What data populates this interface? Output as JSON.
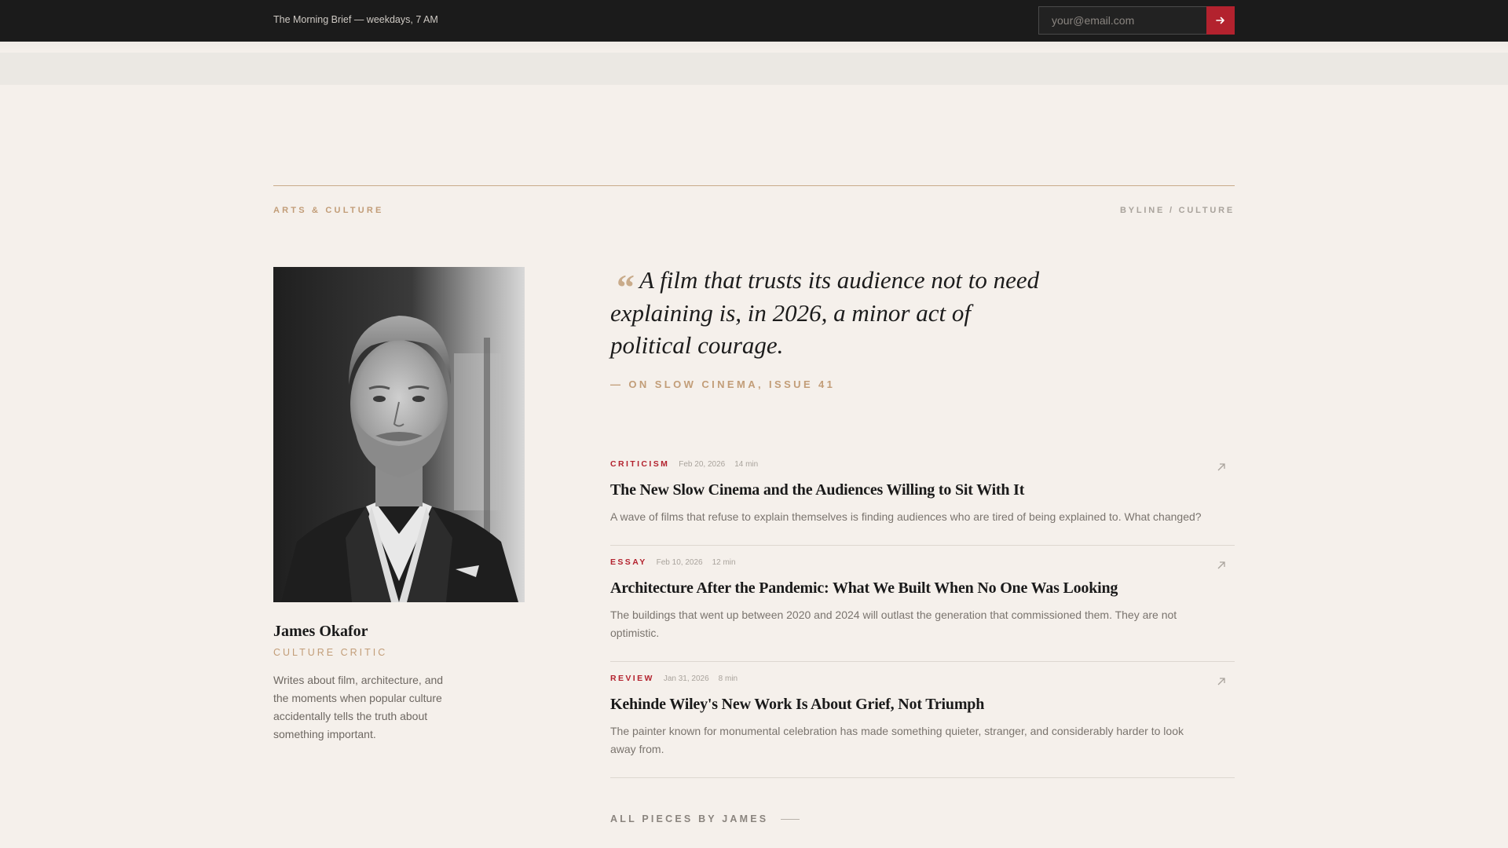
{
  "topbar": {
    "tagline": "The Morning Brief — weekdays, 7 AM",
    "email_placeholder": "your@email.com",
    "submit_icon": "arrow-right-icon"
  },
  "section": {
    "kicker": "ARTS & CULTURE",
    "breadcrumb": "BYLINE / CULTURE"
  },
  "author": {
    "name": "James Okafor",
    "role": "CULTURE CRITIC",
    "bio": "Writes about film, architecture, and the moments when popular culture accidentally tells the truth about something important."
  },
  "quote": {
    "mark": "“",
    "text": "A film that trusts its audience not to need explaining is, in 2026, a minor act of political courage.",
    "source": "— ON SLOW CINEMA, ISSUE 41"
  },
  "articles": [
    {
      "category": "CRITICISM",
      "date": "Feb 20, 2026",
      "read_time": "14 min",
      "title": "The New Slow Cinema and the Audiences Willing to Sit With It",
      "description": "A wave of films that refuse to explain themselves is finding audiences who are tired of being explained to. What changed?"
    },
    {
      "category": "ESSAY",
      "date": "Feb 10, 2026",
      "read_time": "12 min",
      "title": "Architecture After the Pandemic: What We Built When No One Was Looking",
      "description": "The buildings that went up between 2020 and 2024 will outlast the generation that commissioned them. They are not optimistic."
    },
    {
      "category": "REVIEW",
      "date": "Jan 31, 2026",
      "read_time": "8 min",
      "title": "Kehinde Wiley's New Work Is About Grief, Not Triumph",
      "description": "The painter known for monumental celebration has made something quieter, stranger, and considerably harder to look away from."
    }
  ],
  "all_link": "ALL PIECES BY JAMES",
  "colors": {
    "accent_red": "#b3222e",
    "accent_tan": "#c29d78",
    "background": "#f5f0eb",
    "topbar": "#1b1b1b"
  }
}
